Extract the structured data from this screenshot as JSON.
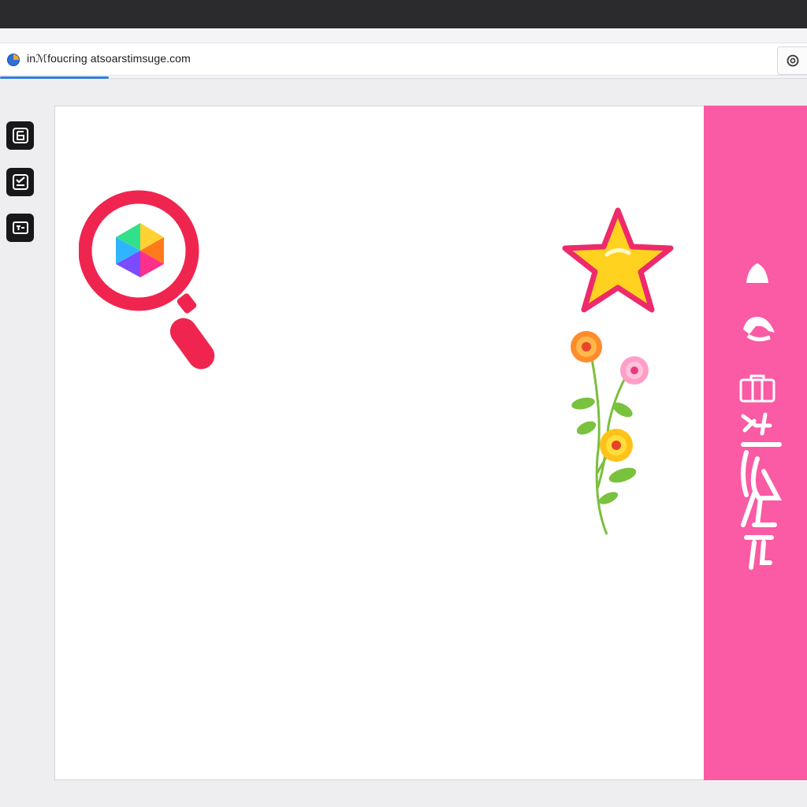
{
  "browser": {
    "url": "inℳfoucring atsoarstimsuge.com",
    "load_progress": 0.135
  },
  "toolbar": {
    "tools": [
      {
        "name": "layout-tool",
        "icon": "text-block-icon"
      },
      {
        "name": "checklist-tool",
        "icon": "checklist-icon"
      },
      {
        "name": "frame-tool",
        "icon": "frame-icon"
      }
    ]
  },
  "canvas": {
    "stickers": [
      "magnifier-sticker",
      "star-sticker",
      "flower-sticker"
    ]
  },
  "side_panel": {
    "color": "#fb5aa4",
    "icons": [
      "bell-icon",
      "cap-icon",
      "briefcase-icon",
      "sparkle-icon",
      "glyph-icon",
      "glyph-icon",
      "glyph-icon"
    ]
  },
  "colors": {
    "accent_blue": "#2f7de1",
    "magnifier_red": "#f0254f",
    "star_yellow": "#ffd21f",
    "star_outline": "#ee2a6b"
  }
}
